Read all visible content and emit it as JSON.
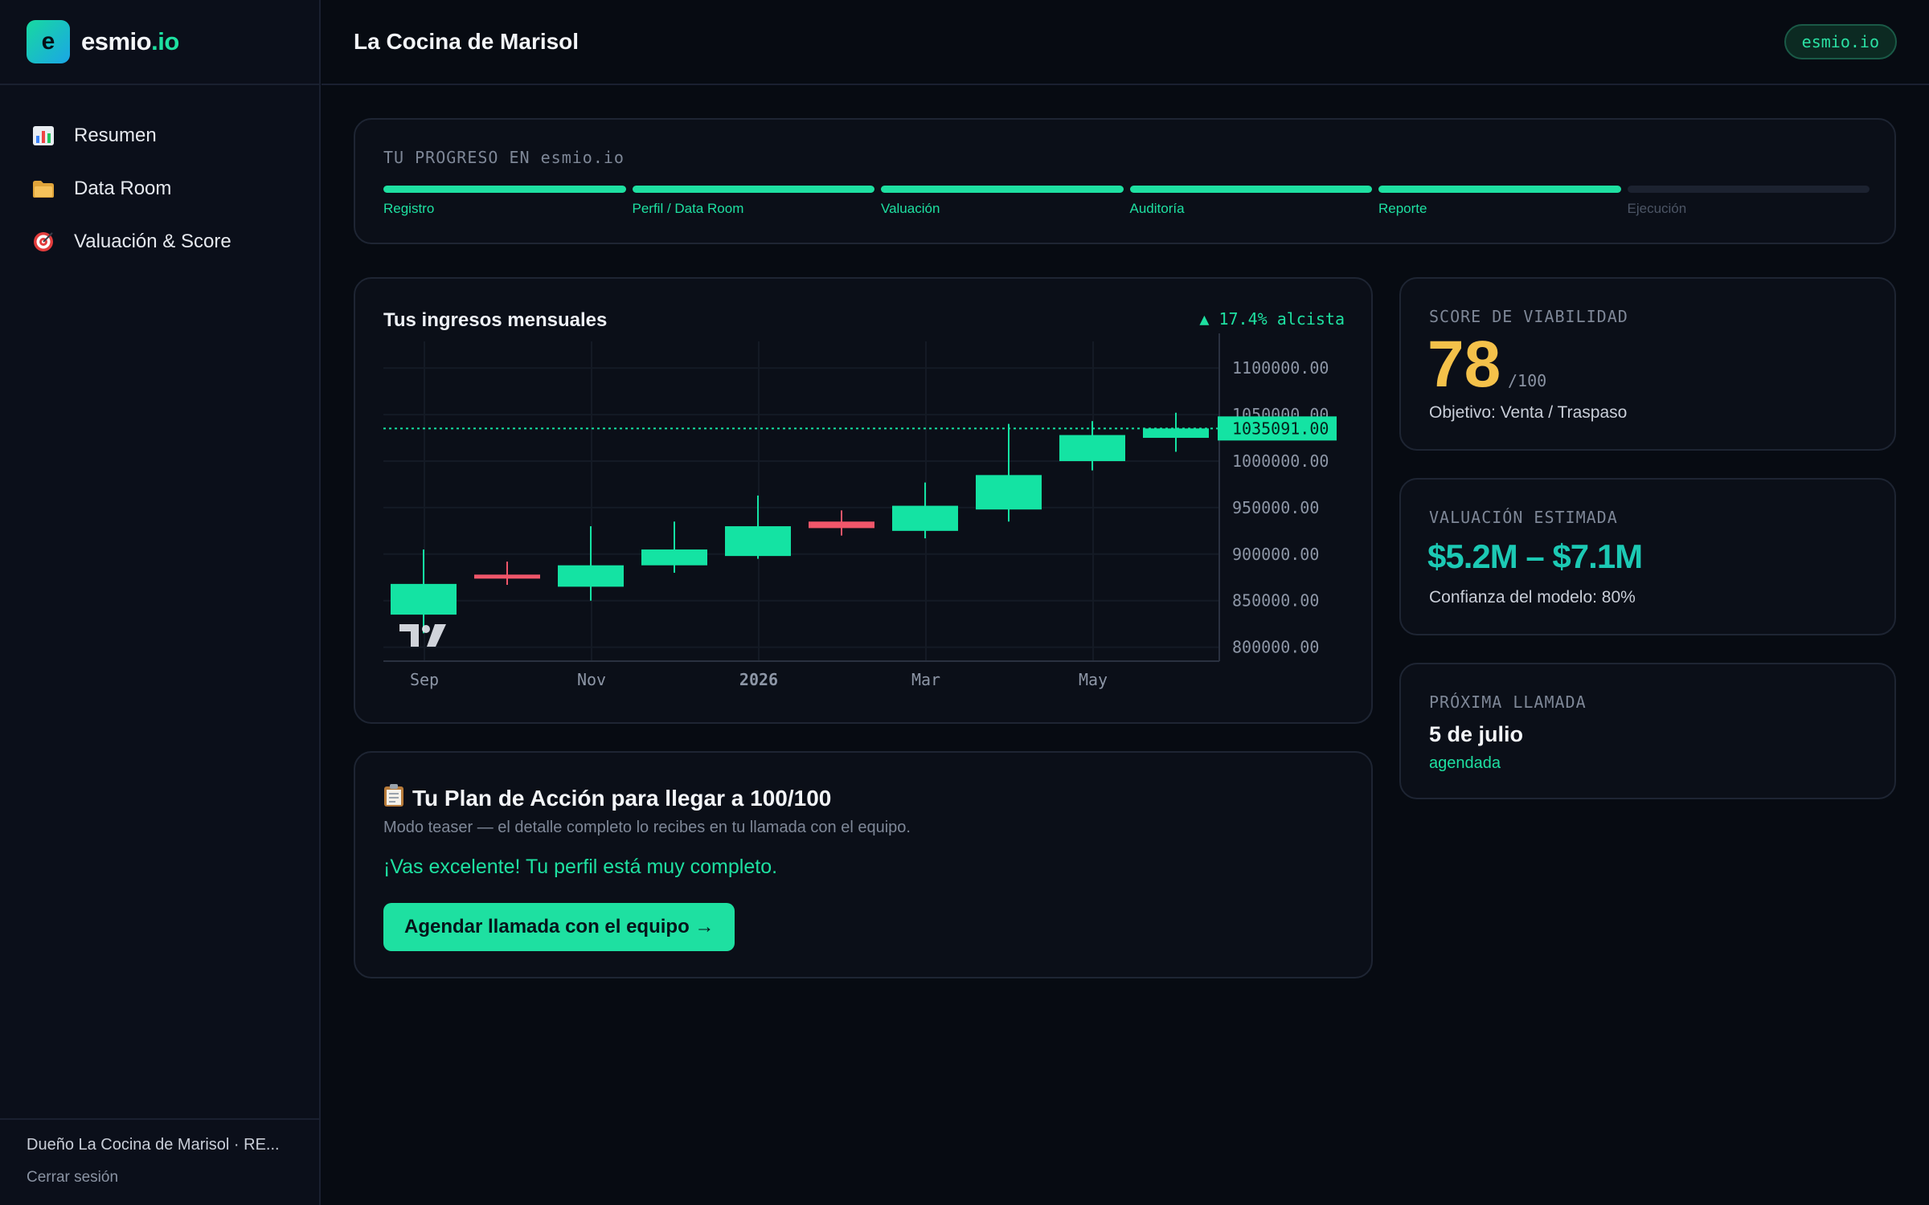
{
  "brand": {
    "logo_letter": "e",
    "name": "esmio",
    "tld": ".io"
  },
  "sidebar": {
    "items": [
      {
        "label": "Resumen",
        "icon": "bar-chart-icon"
      },
      {
        "label": "Data Room",
        "icon": "folder-icon"
      },
      {
        "label": "Valuación & Score",
        "icon": "target-icon"
      }
    ],
    "owner": "Dueño La Cocina de Marisol · RE...",
    "logout": "Cerrar sesión"
  },
  "header": {
    "title": "La Cocina de Marisol",
    "badge": "esmio.io"
  },
  "progress": {
    "label": "TU PROGRESO EN esmio.io",
    "steps": [
      {
        "label": "Registro",
        "done": true
      },
      {
        "label": "Perfil / Data Room",
        "done": true
      },
      {
        "label": "Valuación",
        "done": true
      },
      {
        "label": "Auditoría",
        "done": true
      },
      {
        "label": "Reporte",
        "done": true
      },
      {
        "label": "Ejecución",
        "done": false
      }
    ]
  },
  "revenue": {
    "title": "Tus ingresos mensuales",
    "trend": "▲ 17.4% alcista"
  },
  "chart_data": {
    "type": "candlestick",
    "x_ticks": [
      "Sep",
      "Nov",
      "2026",
      "Mar",
      "May"
    ],
    "y_ticks": [
      "1100000.00",
      "1050000.00",
      "1000000.00",
      "950000.00",
      "900000.00",
      "850000.00",
      "800000.00"
    ],
    "ylim": [
      785000,
      1120000
    ],
    "current_value": 1035091,
    "current_label": "1035091.00",
    "candles": [
      {
        "open": 835000,
        "high": 905000,
        "low": 815000,
        "close": 868000
      },
      {
        "open": 878000,
        "high": 892000,
        "low": 867000,
        "close": 875000
      },
      {
        "open": 865000,
        "high": 930000,
        "low": 850000,
        "close": 888000
      },
      {
        "open": 888000,
        "high": 935000,
        "low": 880000,
        "close": 905000
      },
      {
        "open": 898000,
        "high": 963000,
        "low": 895000,
        "close": 930000
      },
      {
        "open": 935000,
        "high": 947000,
        "low": 920000,
        "close": 928000
      },
      {
        "open": 925000,
        "high": 977000,
        "low": 917000,
        "close": 952000
      },
      {
        "open": 948000,
        "high": 1040000,
        "low": 935000,
        "close": 985000
      },
      {
        "open": 1000000,
        "high": 1043000,
        "low": 990000,
        "close": 1028000
      },
      {
        "open": 1025000,
        "high": 1052000,
        "low": 1010000,
        "close": 1035091
      }
    ],
    "colors": {
      "up": "#14e3a3",
      "down": "#f0566a"
    }
  },
  "action_plan": {
    "icon": "clipboard-icon",
    "title": "Tu Plan de Acción para llegar a 100/100",
    "subtitle": "Modo teaser — el detalle completo lo recibes en tu llamada con el equipo.",
    "message": "¡Vas excelente! Tu perfil está muy completo.",
    "cta": "Agendar llamada con el equipo →"
  },
  "score": {
    "label": "SCORE DE VIABILIDAD",
    "value": "78",
    "denominator": "/100",
    "objective": "Objetivo: Venta / Traspaso"
  },
  "valuation": {
    "label": "VALUACIÓN ESTIMADA",
    "range": "$5.2M – $7.1M",
    "confidence": "Confianza del modelo: 80%"
  },
  "next_call": {
    "label": "PRÓXIMA LLAMADA",
    "date": "5 de julio",
    "status": "agendada"
  }
}
